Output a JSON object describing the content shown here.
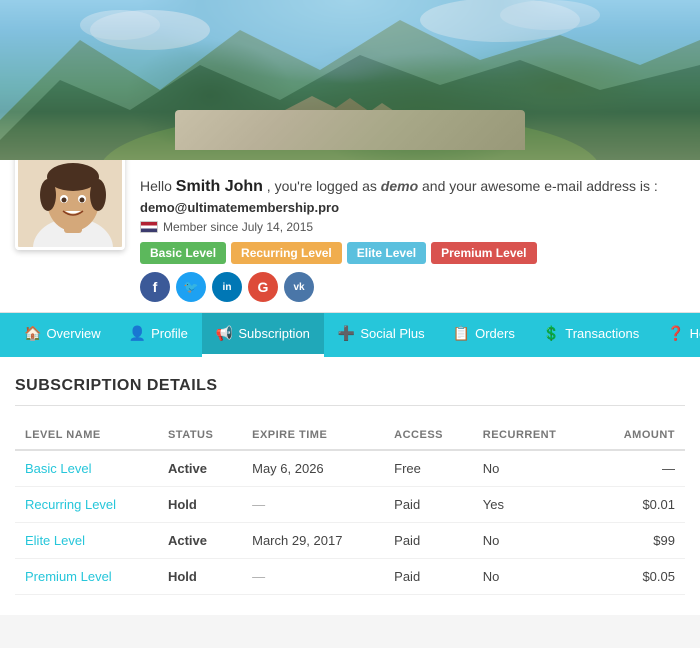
{
  "hero": {
    "alt": "Mountain landscape banner"
  },
  "profile": {
    "greeting_prefix": "Hello",
    "name": "Smith John",
    "logged_as_text": ", you're logged as",
    "demo_username": "demo",
    "email_prefix": "and your awesome e-mail address is :",
    "email": "demo@ultimatemembership.pro",
    "member_since": "Member since July 14, 2015",
    "avatar_alt": "User avatar"
  },
  "badges": [
    {
      "label": "Basic Level",
      "class": "badge-basic"
    },
    {
      "label": "Recurring Level",
      "class": "badge-recurring"
    },
    {
      "label": "Elite Level",
      "class": "badge-elite"
    },
    {
      "label": "Premium Level",
      "class": "badge-premium"
    }
  ],
  "social": [
    {
      "name": "facebook",
      "letter": "f",
      "class": "si-fb"
    },
    {
      "name": "twitter",
      "letter": "t",
      "class": "si-tw"
    },
    {
      "name": "linkedin",
      "letter": "in",
      "class": "si-li"
    },
    {
      "name": "google-plus",
      "letter": "G",
      "class": "si-gp"
    },
    {
      "name": "vk",
      "letter": "vk",
      "class": "si-vk"
    }
  ],
  "nav": {
    "items": [
      {
        "id": "overview",
        "label": "Overview",
        "icon": "🏠"
      },
      {
        "id": "profile",
        "label": "Profile",
        "icon": "👤"
      },
      {
        "id": "subscription",
        "label": "Subscription",
        "icon": "📢",
        "active": true
      },
      {
        "id": "social-plus",
        "label": "Social Plus",
        "icon": "➕"
      },
      {
        "id": "orders",
        "label": "Orders",
        "icon": "📋"
      },
      {
        "id": "transactions",
        "label": "Transactions",
        "icon": "💲"
      },
      {
        "id": "help",
        "label": "Help",
        "icon": "❓"
      },
      {
        "id": "logout",
        "label": "",
        "icon": "🚪"
      }
    ]
  },
  "subscription": {
    "section_title": "SUBSCRIPTION DETAILS",
    "table": {
      "headers": [
        "LEVEL NAME",
        "STATUS",
        "EXPIRE TIME",
        "ACCESS",
        "RECURRENT",
        "AMOUNT"
      ],
      "rows": [
        {
          "level": "Basic Level",
          "status": "Active",
          "status_class": "status-active",
          "expire": "May 6, 2026",
          "access": "Free",
          "recurrent": "No",
          "amount": "—"
        },
        {
          "level": "Recurring Level",
          "status": "Hold",
          "status_class": "status-hold",
          "expire": "—",
          "access": "Paid",
          "recurrent": "Yes",
          "amount": "$0.01"
        },
        {
          "level": "Elite Level",
          "status": "Active",
          "status_class": "status-active",
          "expire": "March 29, 2017",
          "access": "Paid",
          "recurrent": "No",
          "amount": "$99"
        },
        {
          "level": "Premium Level",
          "status": "Hold",
          "status_class": "status-hold",
          "expire": "—",
          "access": "Paid",
          "recurrent": "No",
          "amount": "$0.05"
        }
      ]
    }
  }
}
